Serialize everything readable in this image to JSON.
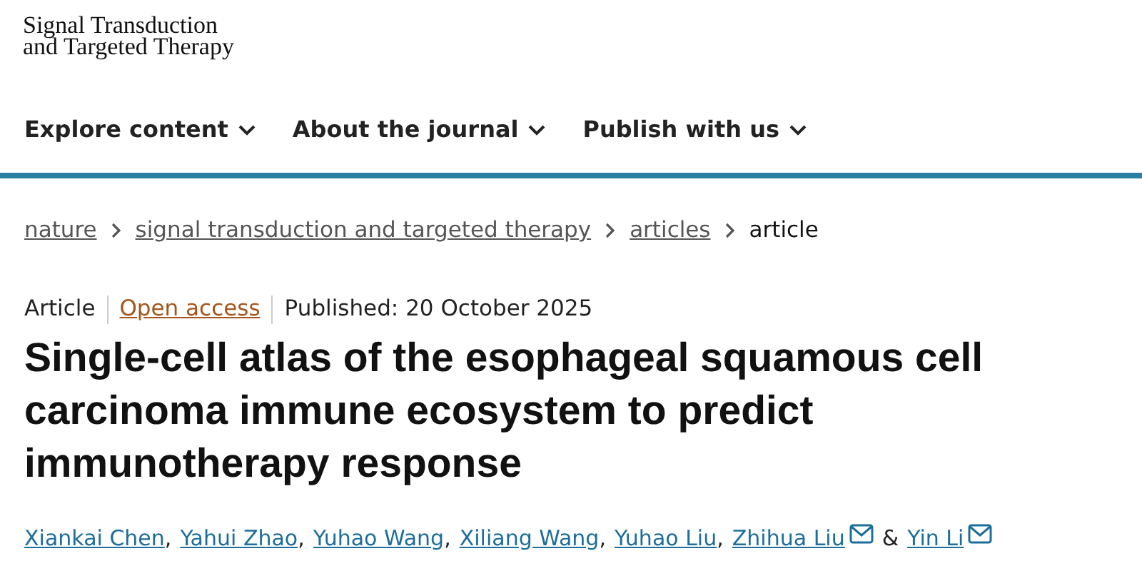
{
  "journal_logo": [
    "Signal Transduction",
    "and Targeted Therapy"
  ],
  "nav": [
    {
      "label": "Explore content"
    },
    {
      "label": "About the journal"
    },
    {
      "label": "Publish with us"
    }
  ],
  "breadcrumb": [
    {
      "label": "nature",
      "link": true
    },
    {
      "label": "signal transduction and targeted therapy",
      "link": true
    },
    {
      "label": "articles",
      "link": true
    },
    {
      "label": "article",
      "link": false
    }
  ],
  "meta": {
    "type": "Article",
    "access": "Open access",
    "published": "Published: 20 October 2025"
  },
  "title": "Single-cell atlas of the esophageal squamous cell carcinoma immune ecosystem to predict immunotherapy response",
  "authors": [
    {
      "name": "Xiankai Chen",
      "mail": false,
      "separator": ","
    },
    {
      "name": "Yahui Zhao",
      "mail": false,
      "separator": ","
    },
    {
      "name": "Yuhao Wang",
      "mail": false,
      "separator": ","
    },
    {
      "name": "Xiliang Wang",
      "mail": false,
      "separator": ","
    },
    {
      "name": "Yuhao Liu",
      "mail": false,
      "separator": ","
    },
    {
      "name": "Zhihua Liu",
      "mail": true,
      "separator": "&"
    },
    {
      "name": "Yin Li",
      "mail": true
    }
  ]
}
